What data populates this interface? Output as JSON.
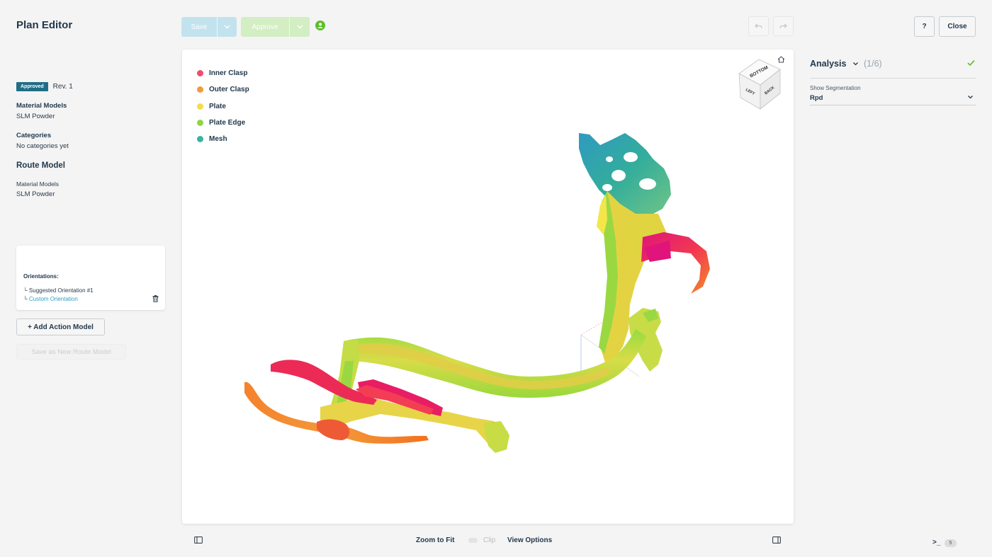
{
  "app": {
    "title": "Plan Editor"
  },
  "left_panel": {
    "status_badge": "Approved",
    "revision": "Rev. 1",
    "material_models_label": "Material Models",
    "material_models_value": "SLM Powder",
    "categories_label": "Categories",
    "categories_value": "No categories yet",
    "route_model_title": "Route Model",
    "route_material_models_label": "Material Models",
    "route_material_models_value": "SLM Powder",
    "orientations": {
      "title": "Orientations:",
      "items": [
        {
          "prefix": "└",
          "label": "Suggested Orientation #1"
        },
        {
          "prefix": "└",
          "label": "Custom Orientation"
        }
      ]
    },
    "add_action_label": "+ Add Action Model",
    "save_new_route_label": "Save as New Route Model"
  },
  "toolbar": {
    "save_label": "Save",
    "approve_label": "Approve",
    "help_label": "?",
    "close_label": "Close"
  },
  "viewport": {
    "legend": [
      {
        "label": "Inner Clasp",
        "color": "#ee4d6e"
      },
      {
        "label": "Outer Clasp",
        "color": "#f59a3c"
      },
      {
        "label": "Plate",
        "color": "#f4dc4a"
      },
      {
        "label": "Plate Edge",
        "color": "#8fd448"
      },
      {
        "label": "Mesh",
        "color": "#3bb3a0"
      }
    ],
    "view_cube": {
      "top": "BOTTOM",
      "left": "LEFT",
      "right": "BACK"
    }
  },
  "bottom_bar": {
    "zoom_to_fit_label": "Zoom to Fit",
    "clip_label": "Clip",
    "view_options_label": "View Options",
    "terminal_prompt": ">_",
    "terminal_count": "5"
  },
  "right_panel": {
    "analysis_title": "Analysis",
    "analysis_count": "(1/6)",
    "segmentation_label": "Show Segmentation",
    "segmentation_value": "Rpd"
  }
}
